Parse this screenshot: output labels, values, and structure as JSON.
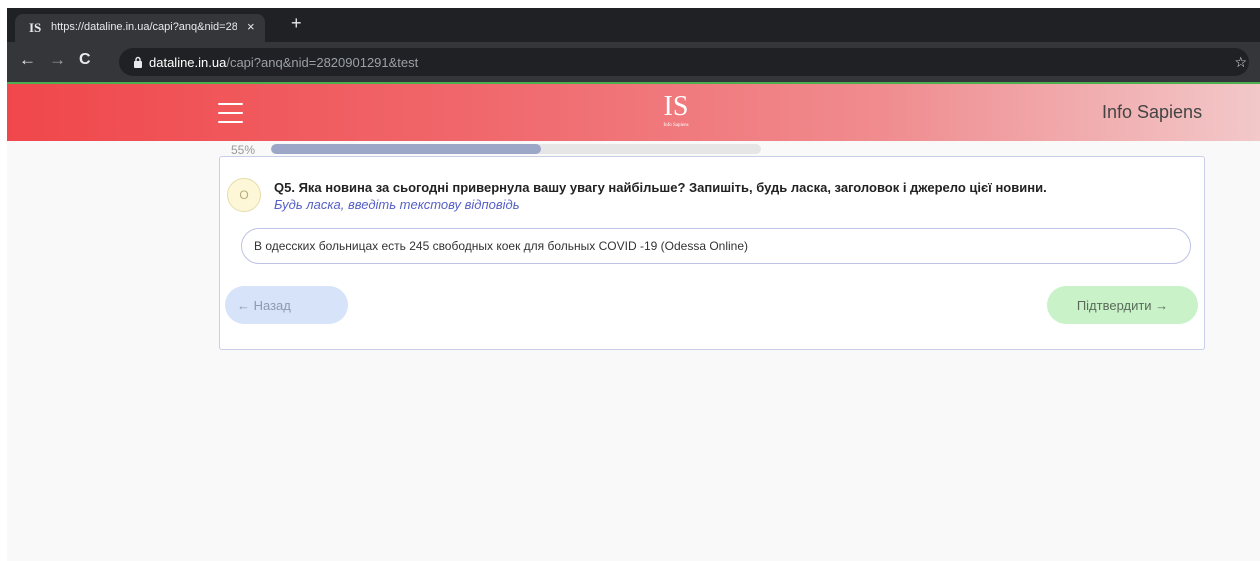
{
  "browser": {
    "tab": {
      "favicon_text": "IS",
      "title": "https://dataline.in.ua/capi?anq&nid=2820901291&test",
      "close_glyph": "×"
    },
    "new_tab_glyph": "+",
    "nav": {
      "back": "←",
      "forward": "→",
      "reload": "C"
    },
    "address": {
      "host": "dataline.in.ua",
      "path": "/capi?anq&nid=2820901291&test"
    },
    "star_glyph": "☆"
  },
  "header": {
    "logo_main": "IS",
    "logo_sub": "Info Sapiens",
    "brand": "Info Sapiens",
    "accent_color": "#f0474b"
  },
  "progress": {
    "label": "55%",
    "value": 55
  },
  "question": {
    "badge": "O",
    "text": "Q5. Яка новина за сьогодні привернула вашу увагу найбільше? Запишіть, будь ласка, заголовок і джерело цієї новини.",
    "hint": "Будь ласка, введіть текстову відповідь",
    "answer_value": "В одесских больницах есть 245 свободных коек для больных COVID -19 (Odessa Online)"
  },
  "buttons": {
    "back_label": "← Назад",
    "confirm_label": "Підтвердити →"
  }
}
